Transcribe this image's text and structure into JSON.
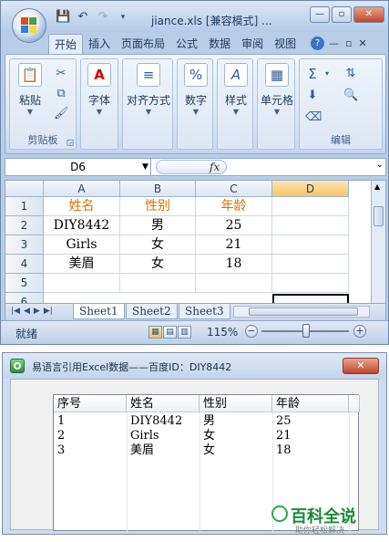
{
  "excel": {
    "title": "jiance.xls  [兼容模式] ...",
    "ribbon_tabs": [
      "开始",
      "插入",
      "页面布局",
      "公式",
      "数据",
      "审阅",
      "视图"
    ],
    "ribbon_groups": {
      "clipboard_label": "剪贴板",
      "paste_label": "粘贴",
      "font_label": "字体",
      "align_label": "对齐方式",
      "number_label": "数字",
      "style_label": "样式",
      "cells_label": "单元格",
      "edit_label": "编辑"
    },
    "name_box": "D6",
    "fx_label": "fx",
    "columns": [
      "A",
      "B",
      "C",
      "D"
    ],
    "rows": [
      "1",
      "2",
      "3",
      "4",
      "5",
      "6"
    ],
    "cells": [
      [
        "姓名",
        "性别",
        "年龄",
        ""
      ],
      [
        "DIY8442",
        "男",
        "25",
        ""
      ],
      [
        "Girls",
        "女",
        "21",
        ""
      ],
      [
        "美眉",
        "女",
        "18",
        ""
      ],
      [
        "",
        "",
        "",
        ""
      ]
    ],
    "sheets": [
      "Sheet1",
      "Sheet2",
      "Sheet3"
    ],
    "status": "就绪",
    "zoom": "115%"
  },
  "dialog": {
    "title": "易语言引用Excel数据——百度ID：DIY8442",
    "close_label": "✕",
    "columns": [
      "序号",
      "姓名",
      "性别",
      "年龄"
    ],
    "rows": [
      [
        "1",
        "DIY8442",
        "男",
        "25"
      ],
      [
        "2",
        "Girls",
        "女",
        "21"
      ],
      [
        "3",
        "美眉",
        "女",
        "18"
      ]
    ]
  },
  "watermark": {
    "title": "百科全说",
    "subtitle": "助你轻松解决"
  },
  "colors": {
    "header_text": "#e07000",
    "selected_column": "#f7c665",
    "ribbon_blue": "#c3d6ee"
  }
}
